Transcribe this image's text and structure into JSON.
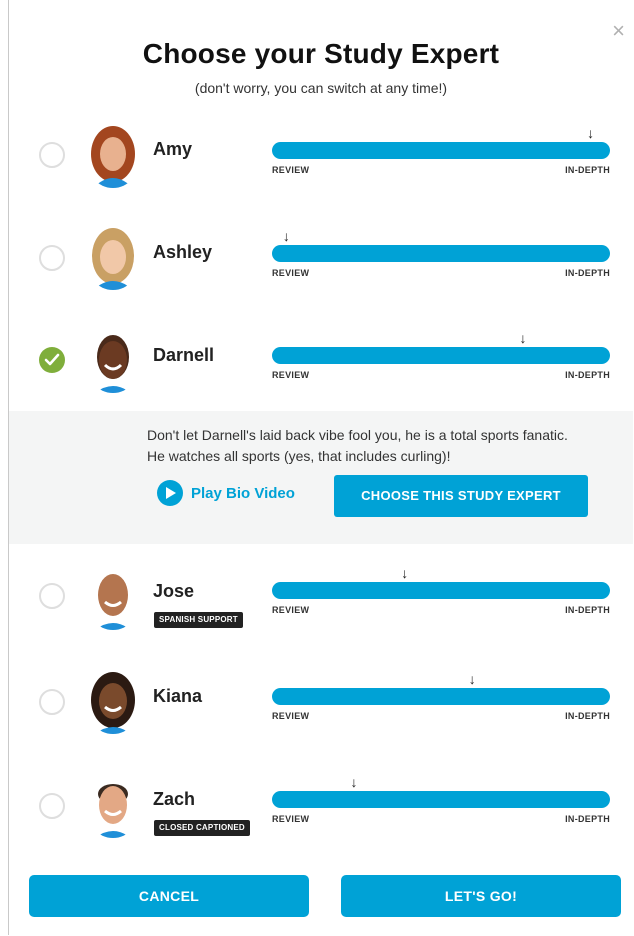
{
  "header": {
    "title": "Choose your Study Expert",
    "subtitle": "(don't worry, you can switch at any time!)",
    "close_icon": "×"
  },
  "scale": {
    "left_label": "REVIEW",
    "right_label": "IN-DEPTH"
  },
  "experts": [
    {
      "name": "Amy",
      "badge": "",
      "selected": false,
      "level": 0.95
    },
    {
      "name": "Ashley",
      "badge": "",
      "selected": false,
      "level": 0.05
    },
    {
      "name": "Darnell",
      "badge": "",
      "selected": true,
      "level": 0.75
    },
    {
      "name": "Jose",
      "badge": "SPANISH SUPPORT",
      "selected": false,
      "level": 0.4
    },
    {
      "name": "Kiana",
      "badge": "",
      "selected": false,
      "level": 0.6
    },
    {
      "name": "Zach",
      "badge": "CLOSED CAPTIONED",
      "selected": false,
      "level": 0.25
    }
  ],
  "detail": {
    "bio": "Don't let Darnell's laid back vibe fool you, he is a total sports fanatic. He watches all sports (yes, that includes curling)!",
    "play_label": "Play Bio Video",
    "choose_label": "CHOOSE THIS STUDY EXPERT"
  },
  "footer": {
    "cancel_label": "CANCEL",
    "go_label": "LET'S GO!"
  },
  "colors": {
    "accent": "#00a2d6",
    "check": "#7fae3b"
  },
  "icons": {
    "arrow": "down-arrow-icon",
    "check": "checkmark-icon",
    "play": "play-icon",
    "close": "close-icon"
  }
}
